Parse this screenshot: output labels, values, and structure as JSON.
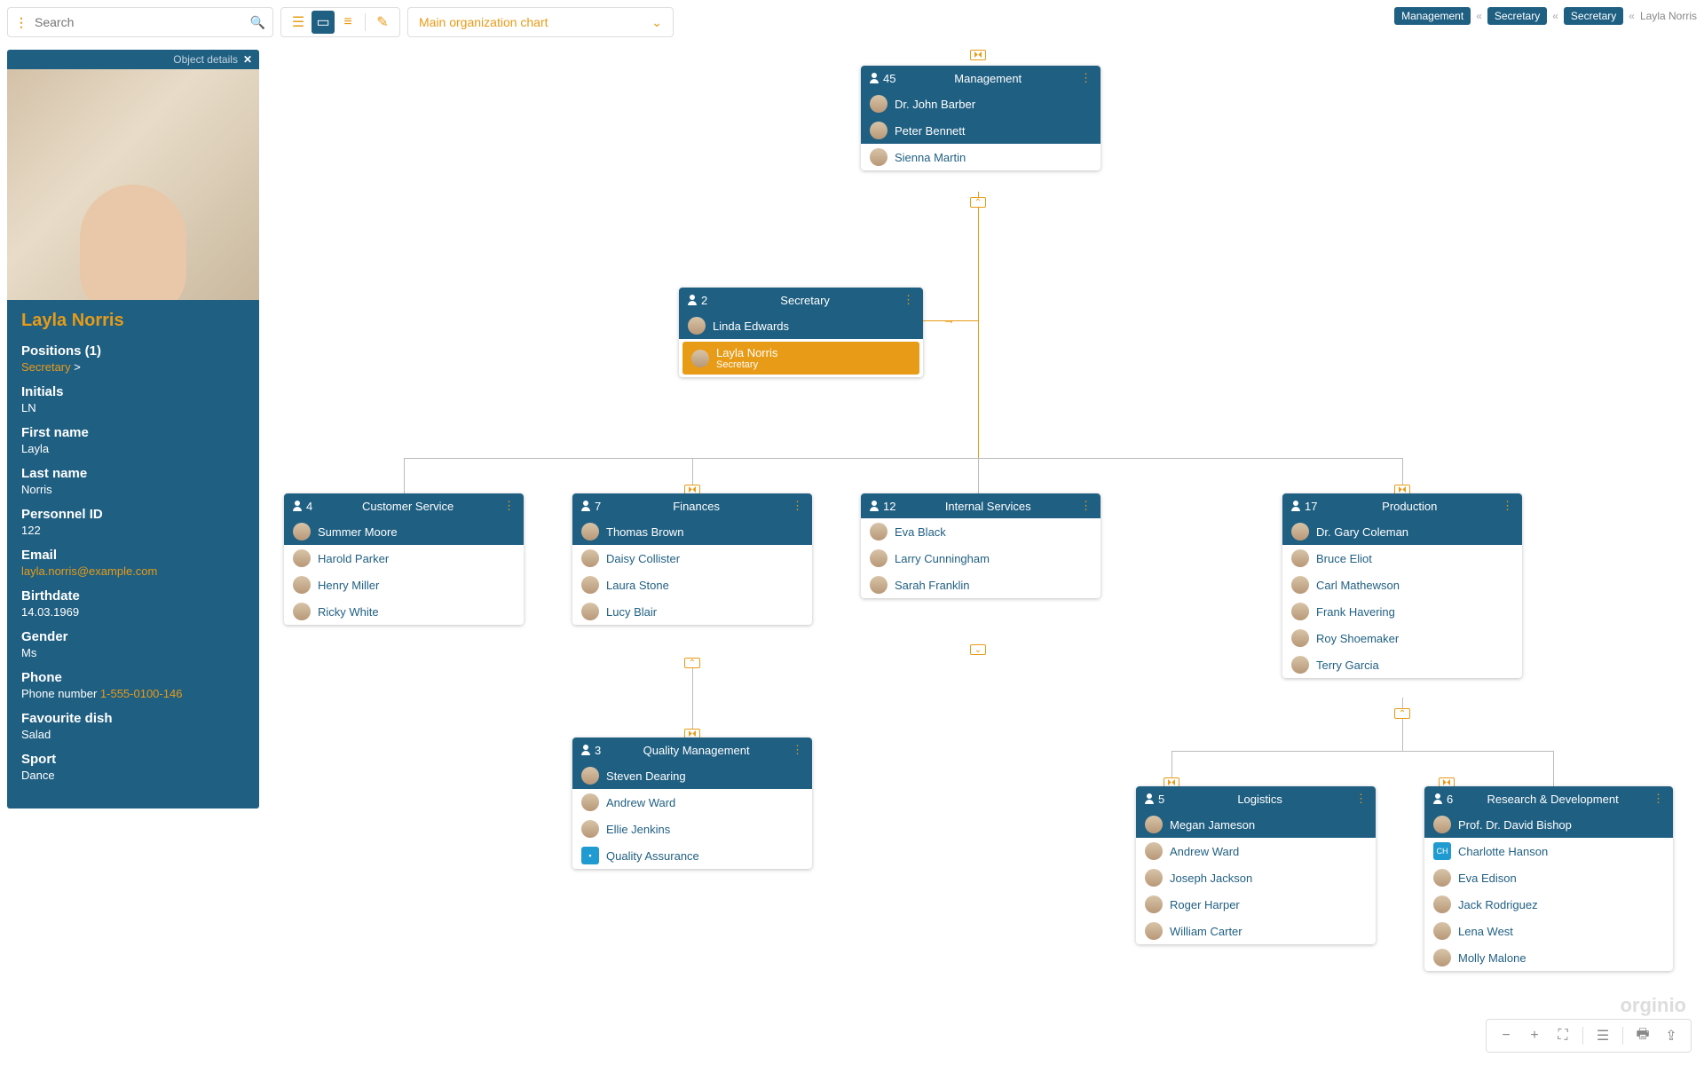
{
  "search": {
    "placeholder": "Search"
  },
  "chart_selector": "Main organization chart",
  "breadcrumb": {
    "path": [
      "Management",
      "Secretary",
      "Secretary"
    ],
    "current": "Layla Norris"
  },
  "details": {
    "header": "Object details",
    "name": "Layla Norris",
    "positions_label": "Positions (1)",
    "position_link": "Secretary",
    "position_suffix": ">",
    "fields": {
      "initials": {
        "label": "Initials",
        "value": "LN"
      },
      "first_name": {
        "label": "First name",
        "value": "Layla"
      },
      "last_name": {
        "label": "Last name",
        "value": "Norris"
      },
      "personnel_id": {
        "label": "Personnel ID",
        "value": "122"
      },
      "email": {
        "label": "Email",
        "value": "layla.norris@example.com"
      },
      "birthdate": {
        "label": "Birthdate",
        "value": "14.03.1969"
      },
      "gender": {
        "label": "Gender",
        "value": "Ms"
      },
      "phone": {
        "label": "Phone",
        "prefix": "Phone number ",
        "value": "1-555-0100-146"
      },
      "dish": {
        "label": "Favourite dish",
        "value": "Salad"
      },
      "sport": {
        "label": "Sport",
        "value": "Dance"
      }
    }
  },
  "nodes": {
    "management": {
      "count": "45",
      "title": "Management",
      "managers": [
        "Dr. John Barber",
        "Peter Bennett"
      ],
      "members": [
        "Sienna Martin"
      ]
    },
    "secretary": {
      "count": "2",
      "title": "Secretary",
      "managers": [
        "Linda Edwards"
      ],
      "highlight": {
        "name": "Layla Norris",
        "role": "Secretary"
      }
    },
    "customer_service": {
      "count": "4",
      "title": "Customer Service",
      "managers": [
        "Summer Moore"
      ],
      "members": [
        "Harold Parker",
        "Henry Miller",
        "Ricky White"
      ]
    },
    "finances": {
      "count": "7",
      "title": "Finances",
      "managers": [
        "Thomas Brown"
      ],
      "members": [
        "Daisy Collister",
        "Laura Stone",
        "Lucy Blair"
      ]
    },
    "internal": {
      "count": "12",
      "title": "Internal Services",
      "members": [
        "Eva Black",
        "Larry Cunningham",
        "Sarah Franklin"
      ]
    },
    "production": {
      "count": "17",
      "title": "Production",
      "managers": [
        "Dr. Gary Coleman"
      ],
      "members": [
        "Bruce Eliot",
        "Carl Mathewson",
        "Frank Havering",
        "Roy Shoemaker",
        "Terry Garcia"
      ]
    },
    "quality": {
      "count": "3",
      "title": "Quality Management",
      "managers": [
        "Steven Dearing"
      ],
      "members": [
        "Andrew Ward",
        "Ellie Jenkins",
        "Quality Assurance"
      ]
    },
    "logistics": {
      "count": "5",
      "title": "Logistics",
      "managers": [
        "Megan Jameson"
      ],
      "members": [
        "Andrew Ward",
        "Joseph Jackson",
        "Roger Harper",
        "William Carter"
      ]
    },
    "rd": {
      "count": "6",
      "title": "Research & Development",
      "managers": [
        "Prof. Dr. David Bishop"
      ],
      "members": [
        "Charlotte Hanson",
        "Eva Edison",
        "Jack Rodriguez",
        "Lena West",
        "Molly Malone"
      ],
      "badge": "CH"
    }
  },
  "brand": "orginio"
}
